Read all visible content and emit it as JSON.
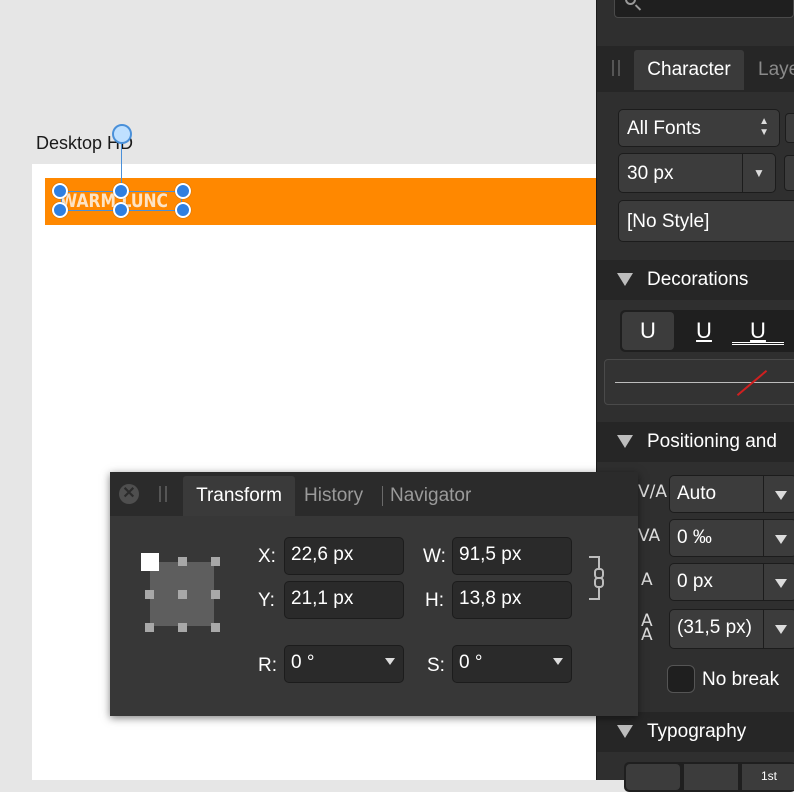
{
  "canvas": {
    "artboard_label": "Desktop HD",
    "banner_text": "WARM LUNC",
    "colors": {
      "banner": "#ff8800",
      "artboard": "#ffffff",
      "canvas_bg": "#e6e6e6",
      "selection": "#2f7fe0"
    }
  },
  "right_panel": {
    "search_icon": "search-icon",
    "tabs": {
      "character": "Character",
      "layers": "Laye"
    },
    "font_family": "All Fonts",
    "font_size": "30 px",
    "style": "[No Style]",
    "sections": {
      "decorations": "Decorations",
      "positioning": "Positioning and",
      "typography": "Typography"
    },
    "decorations": {
      "u1": "U",
      "u2": "U",
      "u3": "U"
    },
    "positioning": {
      "tracking": "Auto",
      "kerning": "0 ‰",
      "baseline": "0 px",
      "leading": "(31,5 px)"
    },
    "no_break": "No break",
    "typography_glyphs": {
      "g3": "1st"
    }
  },
  "transform_panel": {
    "close_icon": "close-icon",
    "tabs": {
      "transform": "Transform",
      "history": "History",
      "navigator": "Navigator"
    },
    "labels": {
      "x": "X:",
      "y": "Y:",
      "w": "W:",
      "h": "H:",
      "r": "R:",
      "s": "S:"
    },
    "values": {
      "x": "22,6 px",
      "y": "21,1 px",
      "w": "91,5 px",
      "h": "13,8 px",
      "r": "0 °",
      "s": "0 °"
    }
  }
}
